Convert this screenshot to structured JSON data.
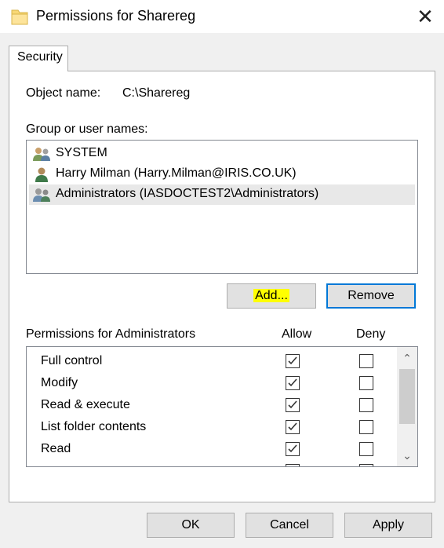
{
  "window": {
    "title": "Permissions for Sharereg",
    "close_label": "✕"
  },
  "tabs": [
    {
      "label": "Security"
    }
  ],
  "object": {
    "label": "Object name:",
    "value": "C:\\Sharereg"
  },
  "groups": {
    "label": "Group or user names:",
    "items": [
      {
        "name": "SYSTEM",
        "icon": "users-group-icon"
      },
      {
        "name": "Harry Milman (Harry.Milman@IRIS.CO.UK)",
        "icon": "user-icon"
      },
      {
        "name": "Administrators (IASDOCTEST2\\Administrators)",
        "icon": "users-group-icon",
        "selected": true
      }
    ]
  },
  "buttons": {
    "add": "Add...",
    "remove": "Remove",
    "ok": "OK",
    "cancel": "Cancel",
    "apply": "Apply"
  },
  "permissions": {
    "header": "Permissions for Administrators",
    "allow_header": "Allow",
    "deny_header": "Deny",
    "rows": [
      {
        "name": "Full control",
        "allow": true,
        "deny": false
      },
      {
        "name": "Modify",
        "allow": true,
        "deny": false
      },
      {
        "name": "Read & execute",
        "allow": true,
        "deny": false
      },
      {
        "name": "List folder contents",
        "allow": true,
        "deny": false
      },
      {
        "name": "Read",
        "allow": true,
        "deny": false
      }
    ]
  },
  "colors": {
    "focus_border": "#0078d7",
    "highlight": "#ffff00",
    "dialog_bg": "#f0f0f0"
  }
}
